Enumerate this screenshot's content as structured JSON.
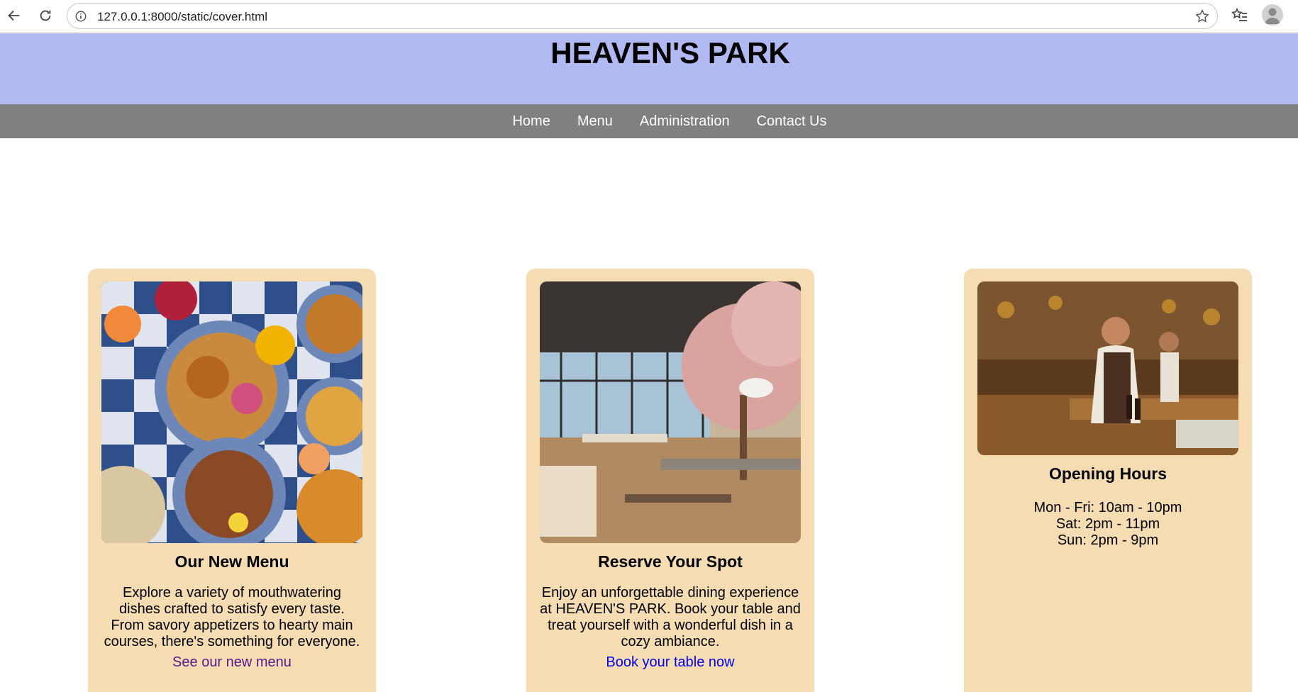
{
  "browser": {
    "url": "127.0.0.1:8000/static/cover.html"
  },
  "site": {
    "title": "HEAVEN'S PARK"
  },
  "nav": {
    "items": [
      "Home",
      "Menu",
      "Administration",
      "Contact Us"
    ]
  },
  "cards": {
    "menu": {
      "title": "Our New Menu",
      "text": "Explore a variety of mouthwatering dishes crafted to satisfy every taste. From savory appetizers to hearty main courses, there's something for everyone.",
      "link": "See our new menu",
      "link_color": "#551a8b"
    },
    "reserve": {
      "title": "Reserve Your Spot",
      "text": "Enjoy an unforgettable dining experience at HEAVEN'S PARK. Book your table and treat yourself with a wonderful dish in a cozy ambiance.",
      "link": "Book your table now",
      "link_color": "#0000ee"
    },
    "hours": {
      "title": "Opening Hours",
      "lines": [
        "Mon - Fri: 10am - 10pm",
        "Sat: 2pm - 11pm",
        "Sun: 2pm - 9pm"
      ]
    }
  },
  "colors": {
    "header_bg": "#b1b9f3",
    "nav_bg": "#808080",
    "card_bg": "#f5dcb3"
  }
}
